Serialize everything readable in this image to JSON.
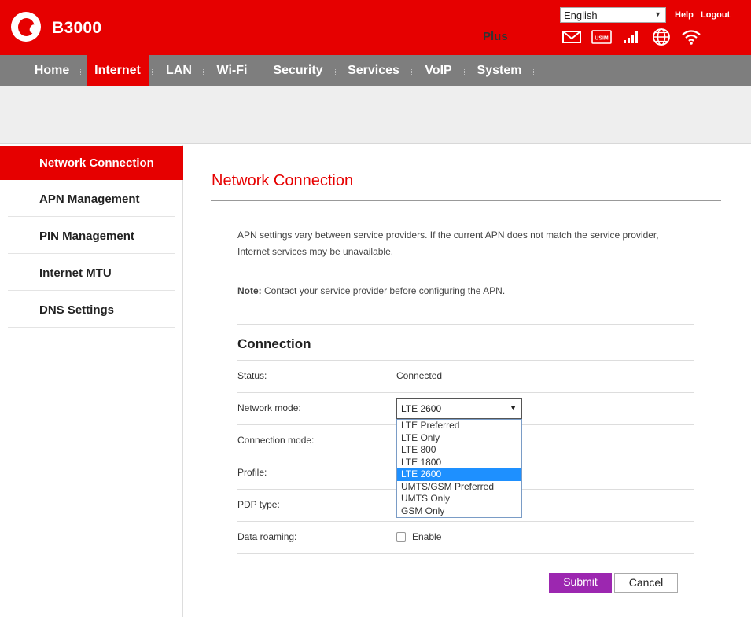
{
  "header": {
    "model": "B3000",
    "operator_tag": "Plus",
    "language": "English",
    "help": "Help",
    "logout": "Logout",
    "status_icons": [
      "mail-icon",
      "usim-icon",
      "signal-icon",
      "globe-icon",
      "wifi-icon"
    ]
  },
  "nav": {
    "items": [
      "Home",
      "Internet",
      "LAN",
      "Wi-Fi",
      "Security",
      "Services",
      "VoIP",
      "System"
    ],
    "active": "Internet"
  },
  "sidebar": {
    "items": [
      "Network Connection",
      "APN Management",
      "PIN Management",
      "Internet MTU",
      "DNS Settings"
    ],
    "active": "Network Connection"
  },
  "main": {
    "title": "Network Connection",
    "description": "APN settings vary between service providers. If the current APN does not match the service provider, Internet services may be unavailable.",
    "note_label": "Note:",
    "note_text": " Contact your service provider before configuring the APN.",
    "section_title": "Connection",
    "fields": {
      "status_label": "Status:",
      "status_value": "Connected",
      "network_mode_label": "Network mode:",
      "network_mode_value": "LTE 2600",
      "connection_mode_label": "Connection mode:",
      "profile_label": "Profile:",
      "pdp_type_label": "PDP type:",
      "data_roaming_label": "Data roaming:",
      "data_roaming_option": "Enable",
      "data_roaming_checked": false
    },
    "network_mode_options": [
      "LTE Preferred",
      "LTE Only",
      "LTE 800",
      "LTE 1800",
      "LTE 2600",
      "UMTS/GSM Preferred",
      "UMTS Only",
      "GSM Only"
    ],
    "network_mode_selected": "LTE 2600",
    "submit": "Submit",
    "cancel": "Cancel"
  },
  "colors": {
    "brand_red": "#e60000",
    "nav_gray": "#7e7e7e",
    "submit_purple": "#9c27b0",
    "highlight_blue": "#1e90ff"
  }
}
